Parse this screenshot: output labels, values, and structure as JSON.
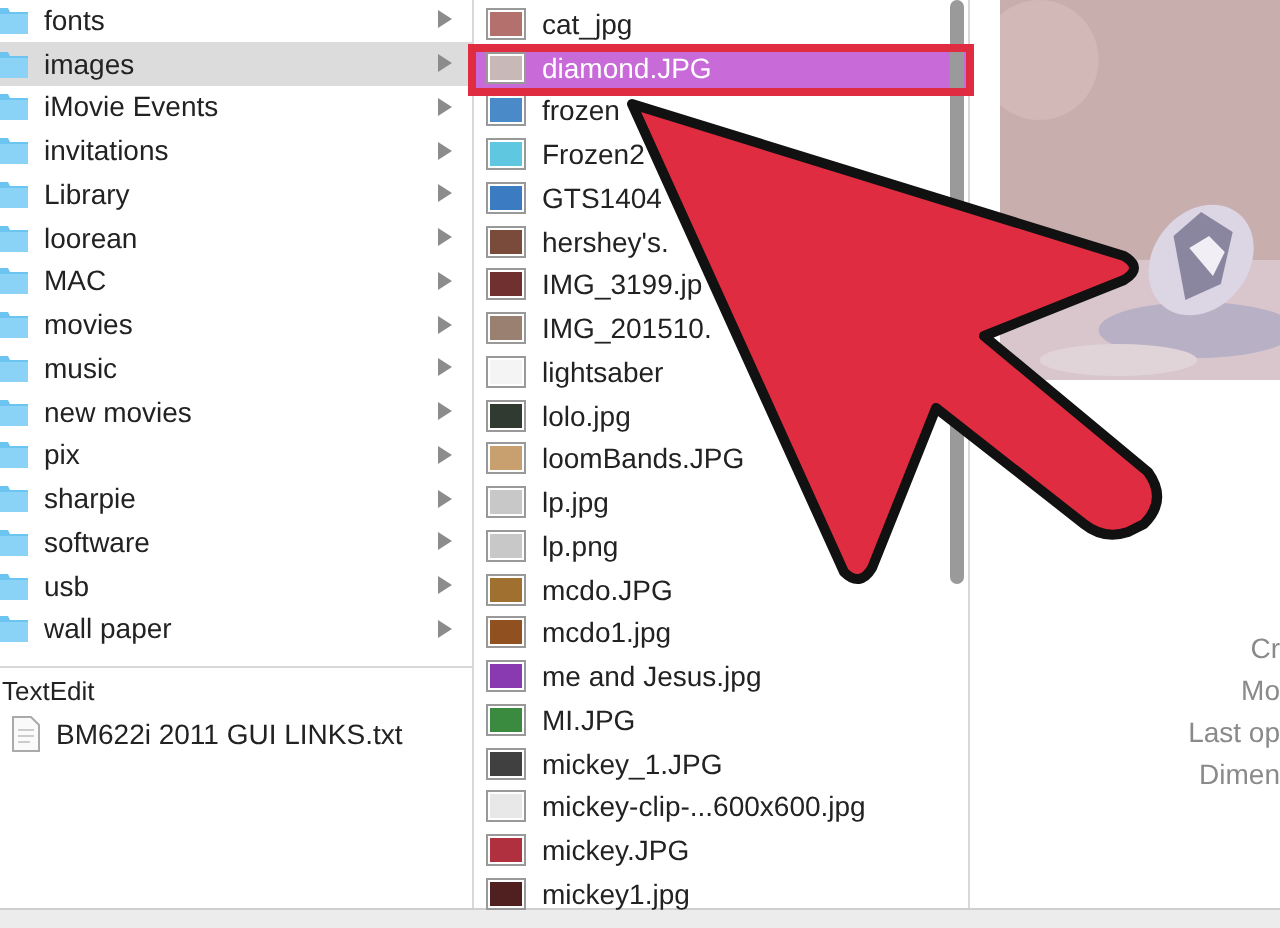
{
  "folder_column": {
    "active": false,
    "items": [
      {
        "name": "fonts",
        "selected": false
      },
      {
        "name": "images",
        "selected": true
      },
      {
        "name": "iMovie Events",
        "selected": false
      },
      {
        "name": "invitations",
        "selected": false
      },
      {
        "name": "Library",
        "selected": false
      },
      {
        "name": "loorean",
        "selected": false
      },
      {
        "name": "MAC",
        "selected": false
      },
      {
        "name": "movies",
        "selected": false
      },
      {
        "name": "music",
        "selected": false
      },
      {
        "name": "new movies",
        "selected": false
      },
      {
        "name": "pix",
        "selected": false
      },
      {
        "name": "sharpie",
        "selected": false
      },
      {
        "name": "software",
        "selected": false
      },
      {
        "name": "usb",
        "selected": false
      },
      {
        "name": "wall paper",
        "selected": false
      }
    ],
    "group_label": "TextEdit",
    "group_items": [
      {
        "name": "BM622i 2011 GUI LINKS.txt",
        "selected": false
      }
    ]
  },
  "file_column": {
    "active": true,
    "items": [
      {
        "name": "cat_jpg",
        "selected": false
      },
      {
        "name": "diamond.JPG",
        "selected": true
      },
      {
        "name": "frozen",
        "selected": false
      },
      {
        "name": "Frozen2",
        "selected": false
      },
      {
        "name": "GTS1404",
        "selected": false
      },
      {
        "name": "hershey's.",
        "selected": false
      },
      {
        "name": "IMG_3199.jp",
        "selected": false
      },
      {
        "name": "IMG_201510.",
        "selected": false
      },
      {
        "name": "lightsaber",
        "selected": false
      },
      {
        "name": "lolo.jpg",
        "selected": false
      },
      {
        "name": "loomBands.JPG",
        "selected": false
      },
      {
        "name": "lp.jpg",
        "selected": false
      },
      {
        "name": "lp.png",
        "selected": false
      },
      {
        "name": "mcdo.JPG",
        "selected": false
      },
      {
        "name": "mcdo1.jpg",
        "selected": false
      },
      {
        "name": "me and Jesus.jpg",
        "selected": false
      },
      {
        "name": "MI.JPG",
        "selected": false
      },
      {
        "name": "mickey_1.JPG",
        "selected": false
      },
      {
        "name": "mickey-clip-...600x600.jpg",
        "selected": false
      },
      {
        "name": "mickey.JPG",
        "selected": false
      },
      {
        "name": "mickey1.jpg",
        "selected": false
      }
    ]
  },
  "preview": {
    "kind": "picture",
    "info_labels": [
      "Cr",
      "Mo",
      "Last op",
      "Dimen"
    ]
  }
}
